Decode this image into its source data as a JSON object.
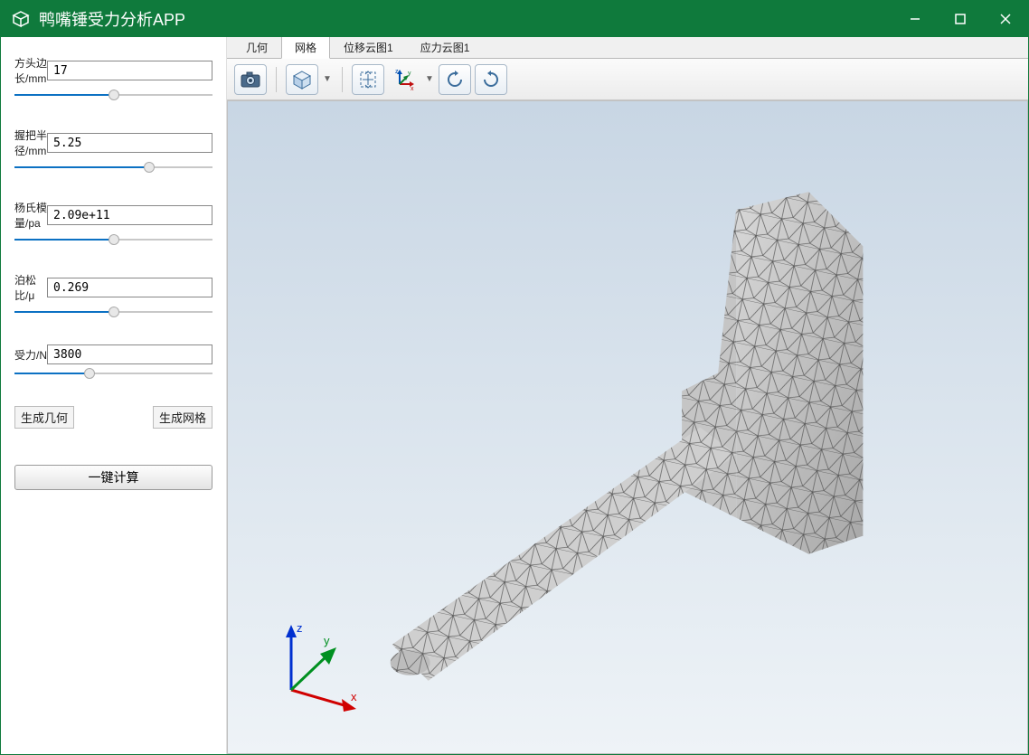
{
  "titlebar": {
    "title": "鸭嘴锤受力分析APP"
  },
  "params": {
    "head_length": {
      "label": "方头边长/mm",
      "value": "17",
      "slider_pct": 50
    },
    "grip_radius": {
      "label": "握把半径/mm",
      "value": "5.25",
      "slider_pct": 68
    },
    "youngs": {
      "label": "杨氏模量/pa",
      "value": "2.09e+11",
      "slider_pct": 50
    },
    "poisson": {
      "label": "泊松比/μ",
      "value": "0.269",
      "slider_pct": 50
    },
    "force": {
      "label": "受力/N",
      "value": "3800",
      "slider_pct": 38
    }
  },
  "buttons": {
    "gen_geom": "生成几何",
    "gen_mesh": "生成网格",
    "compute": "一键计算"
  },
  "tabs": {
    "geometry": "几何",
    "mesh": "网格",
    "disp": "位移云图1",
    "stress": "应力云图1",
    "active": "mesh"
  },
  "triad": {
    "x": "x",
    "y": "y",
    "z": "z"
  },
  "icons": {
    "camera": "camera-icon",
    "cube": "cube-icon",
    "fit": "fit-icon",
    "axes": "axes-icon",
    "rotate_cw": "rotate-cw-icon",
    "rotate_ccw": "rotate-ccw-icon"
  }
}
